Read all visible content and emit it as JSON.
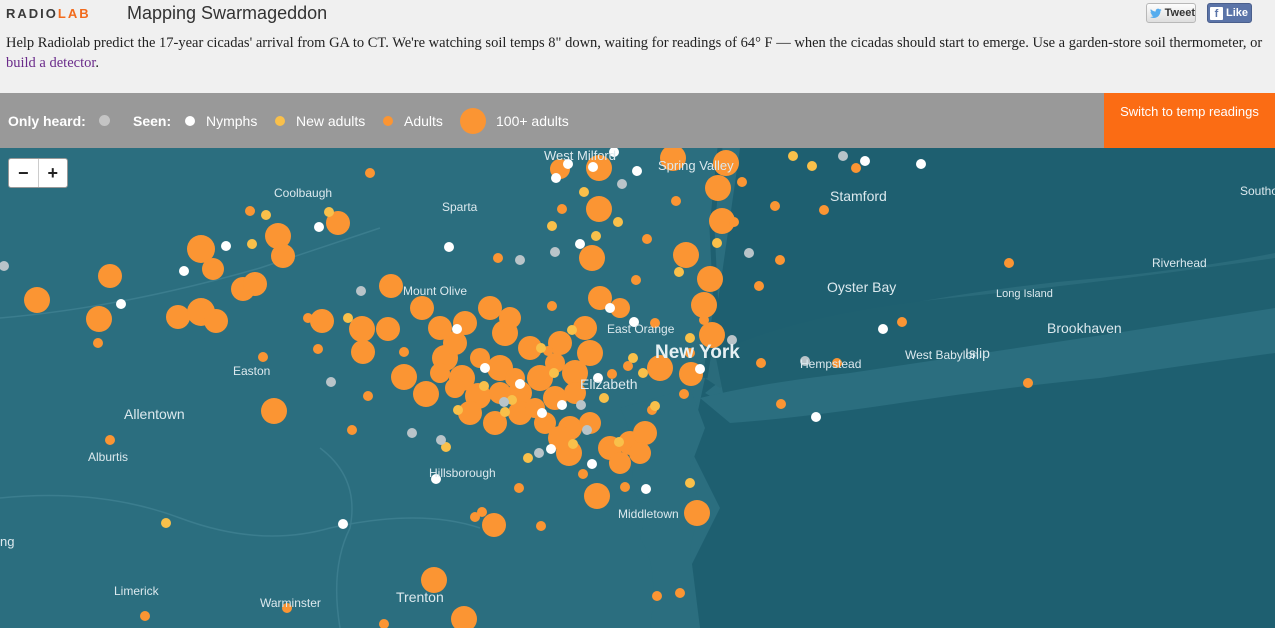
{
  "header": {
    "logo_part1": "RADIO",
    "logo_part2": "LAB",
    "title": "Mapping Swarmageddon",
    "tweet_label": "Tweet",
    "like_label": "Like",
    "intro_text": "Help Radiolab predict the 17-year cicadas' arrival from GA to CT. We're watching soil temps 8\" down, waiting for readings of 64° F — when the cicadas should start to emerge. Use a garden-store soil thermometer, or ",
    "intro_link": "build a detector",
    "intro_end": "."
  },
  "legend": {
    "only_heard_label": "Only heard:",
    "seen_label": "Seen:",
    "nymphs_label": "Nymphs",
    "new_adults_label": "New adults",
    "adults_label": "Adults",
    "hundred_adults_label": "100+ adults"
  },
  "switch_label": "Switch to temp readings",
  "zoom": {
    "minus": "−",
    "plus": "+"
  },
  "colors": {
    "heard": "#b9c4c9",
    "nymph": "#ffffff",
    "new_adult": "#f9c04a",
    "adult": "#fb9533",
    "land": "#2c6f80",
    "water": "#1d5d6e",
    "accent": "#fb6c14"
  },
  "places": [
    "West Milford",
    "Spring Valley",
    "Stamford",
    "Southold",
    "Coolbaugh",
    "Sparta",
    "Riverhead",
    "Oyster Bay",
    "Long Island",
    "Mount Olive",
    "East Orange",
    "Brookhaven",
    "New York",
    "Hempstead",
    "West Babylon",
    "Islip",
    "Easton",
    "Elizabeth",
    "Allentown",
    "Alburtis",
    "Hillsborough",
    "Middletown",
    "Limerick",
    "Warminster",
    "Trenton"
  ]
}
